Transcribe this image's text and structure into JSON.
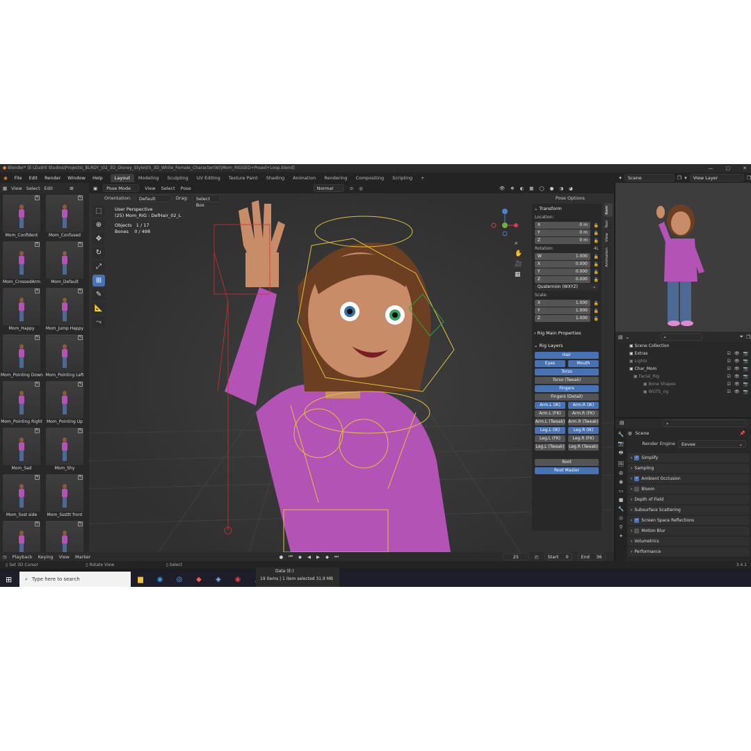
{
  "window": {
    "title": "Blender* [E:\\Zudrit Studios\\Projects\\_BLRDY_\\02_3D_Disney_Style\\05_3D_White_Female_Character(W)\\Mom_RIGGED+Posed+Loop.blend]"
  },
  "menu": [
    "File",
    "Edit",
    "Render",
    "Window",
    "Help"
  ],
  "workspaces": [
    "Layout",
    "Modeling",
    "Sculpting",
    "UV Editing",
    "Texture Paint",
    "Shading",
    "Animation",
    "Rendering",
    "Compositing",
    "Scripting"
  ],
  "active_workspace": "Layout",
  "header_right": {
    "scene_label": "Scene",
    "view_layer_label": "View Layer"
  },
  "asset_header": [
    "View",
    "Select",
    "Edit"
  ],
  "assets": [
    {
      "label": "Mom_Confident"
    },
    {
      "label": "Mom_Confused"
    },
    {
      "label": "Mom_CrossedArm"
    },
    {
      "label": "Mom_Default"
    },
    {
      "label": "Mom_Happy"
    },
    {
      "label": "Mom_Jump Happy"
    },
    {
      "label": "Mom_Pointing Down"
    },
    {
      "label": "Mom_Pointing Left"
    },
    {
      "label": "Mom_Pointing Right"
    },
    {
      "label": "Mom_Pointing Up"
    },
    {
      "label": "Mom_Sad"
    },
    {
      "label": "Mom_Shy"
    },
    {
      "label": "Mom_Ssst side"
    },
    {
      "label": "Mom_Sssttt front"
    },
    {
      "label": ""
    },
    {
      "label": ""
    }
  ],
  "viewport": {
    "mode": "Pose Mode",
    "menu": [
      "View",
      "Select",
      "Pose"
    ],
    "shading": "Normal",
    "orientation_label": "Orientation:",
    "orientation_value": "Default",
    "drag_label": "Drag:",
    "drag_value": "Select Box",
    "pose_options": "Pose Options",
    "info": {
      "perspective": "User Perspective",
      "object": "(25) Mom_RIG : DefHair_02_L",
      "objects_label": "Objects",
      "objects_value": "1 / 17",
      "bones_label": "Bones",
      "bones_value": "0 / 498"
    }
  },
  "npanel": {
    "tabs": [
      "Item",
      "Tool",
      "View",
      "Animation"
    ],
    "transform_title": "Transform",
    "location_label": "Location:",
    "location": [
      {
        "axis": "X",
        "value": "0 m"
      },
      {
        "axis": "Y",
        "value": "0 m"
      },
      {
        "axis": "Z",
        "value": "0 m"
      }
    ],
    "rotation_label": "Rotation:",
    "rotation_mode_short": "4L",
    "rotation": [
      {
        "axis": "W",
        "value": "1.000"
      },
      {
        "axis": "X",
        "value": "0.000"
      },
      {
        "axis": "Y",
        "value": "0.000"
      },
      {
        "axis": "Z",
        "value": "0.000"
      }
    ],
    "rotation_mode": "Quaternion (WXYZ)",
    "scale_label": "Scale:",
    "scale": [
      {
        "axis": "X",
        "value": "1.000"
      },
      {
        "axis": "Y",
        "value": "1.000"
      },
      {
        "axis": "Z",
        "value": "1.000"
      }
    ],
    "rig_main_title": "Rig Main Properties",
    "rig_layers_title": "Rig Layers",
    "rig": {
      "hair": "Hair",
      "eyes": "Eyes",
      "mouth": "Mouth",
      "torso": "Torso",
      "torso_tweak": "Torso (Tweak)",
      "fingers": "Fingers",
      "fingers_detail": "Fingers (Detail)",
      "arm_l_ik": "Arm.L (IK)",
      "arm_r_ik": "Arm.R (IK)",
      "arm_l_fk": "Arm.L (FK)",
      "arm_r_fk": "Arm.R (FK)",
      "arm_l_tweak": "Arm.L (Tweak)",
      "arm_r_tweak": "Arm.R (Tweak)",
      "leg_l_ik": "Leg.L (IK)",
      "leg_r_ik": "Leg.R (IK)",
      "leg_l_fk": "Leg.L (FK)",
      "leg_r_fk": "Leg.R (FK)",
      "leg_l_tweak": "Leg.L (Tweak)",
      "leg_r_tweak": "Leg.R (Tweak)",
      "root": "Root",
      "root_master": "Root Master"
    }
  },
  "timeline": {
    "menu": [
      "Playback",
      "Keying",
      "View",
      "Marker"
    ],
    "current_frame": "25",
    "start_label": "Start",
    "start": "0",
    "end_label": "End",
    "end": "36"
  },
  "statusbar": {
    "left": "Set 3D Cursor",
    "middle": "Rotate View",
    "right": "Select",
    "version": "3.4.1"
  },
  "outliner": {
    "root": "Scene Collection",
    "items": [
      {
        "name": "Extras",
        "dim": false
      },
      {
        "name": "Lights",
        "dim": true
      },
      {
        "name": "Char_Mom",
        "dim": false
      },
      {
        "name": "Facial_Rig",
        "dim": true
      },
      {
        "name": "Bone Shapes",
        "dim": true
      },
      {
        "name": "WGTS_rig",
        "dim": true
      }
    ]
  },
  "properties": {
    "title": "Scene",
    "render_engine_label": "Render Engine",
    "render_engine": "Eevee",
    "sections": [
      {
        "name": "Simplify",
        "check": "on"
      },
      {
        "name": "Sampling",
        "check": "none"
      },
      {
        "name": "Ambient Occlusion",
        "check": "on"
      },
      {
        "name": "Bloom",
        "check": "off"
      },
      {
        "name": "Depth of Field",
        "check": "none"
      },
      {
        "name": "Subsurface Scattering",
        "check": "none"
      },
      {
        "name": "Screen Space Reflections",
        "check": "on"
      },
      {
        "name": "Motion Blur",
        "check": "off"
      },
      {
        "name": "Volumetrics",
        "check": "none"
      },
      {
        "name": "Performance",
        "check": "none"
      }
    ]
  },
  "taskbar": {
    "search_placeholder": "Type here to search",
    "explorer_drive": "Data (E:)",
    "explorer_status": "19 items  |  1 item selected  31.9 MB"
  },
  "colors": {
    "accent": "#4772b3",
    "shirt": "#b453b6",
    "bone": "#e0c23a",
    "bone_red": "#d03030"
  }
}
